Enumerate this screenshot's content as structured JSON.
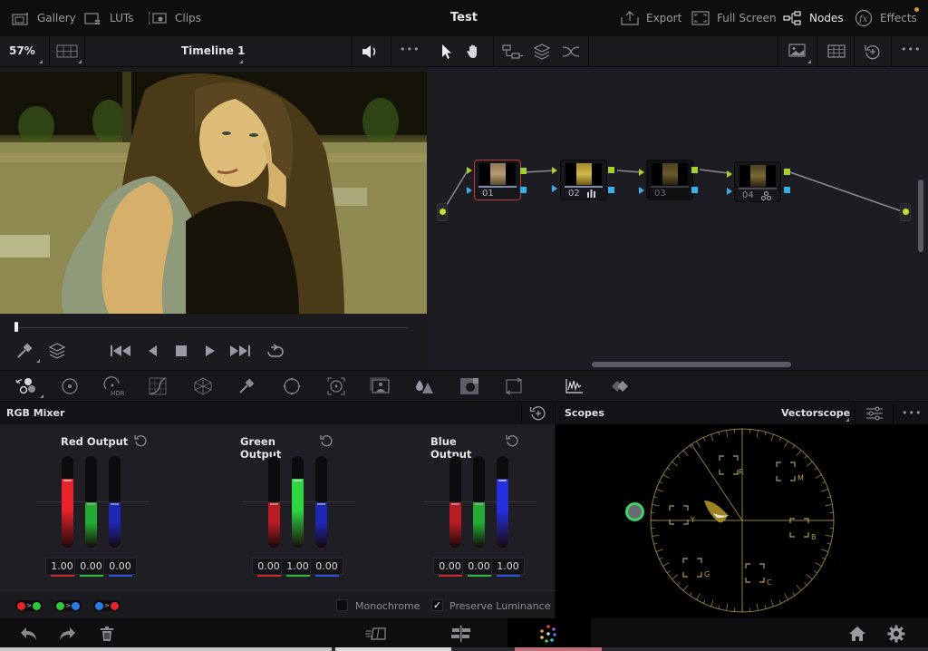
{
  "topbar": {
    "title": "Test",
    "left_items": [
      {
        "label": "Gallery",
        "icon": "gallery-icon"
      },
      {
        "label": "LUTs",
        "icon": "luts-icon"
      },
      {
        "label": "Clips",
        "icon": "clips-icon"
      }
    ],
    "right_items": [
      {
        "label": "Export",
        "icon": "export-icon"
      },
      {
        "label": "Full Screen",
        "icon": "fullscreen-icon"
      },
      {
        "label": "Nodes",
        "icon": "nodes-icon",
        "active": true
      },
      {
        "label": "Effects",
        "icon": "fx-icon"
      }
    ]
  },
  "viewer": {
    "zoom": "57%",
    "timeline": "Timeline 1",
    "more": "•••",
    "playhead_fraction": 0.0
  },
  "nodegraph": {
    "more": "•••",
    "nodes": [
      {
        "id": "01",
        "selected": true,
        "badge": ""
      },
      {
        "id": "02",
        "selected": false,
        "badge": "bars"
      },
      {
        "id": "03",
        "selected": false,
        "badge": ""
      },
      {
        "id": "04",
        "selected": false,
        "badge": "layer"
      }
    ]
  },
  "palette": {
    "tools": [
      "color-wheels",
      "primary-wheel",
      "hdr",
      "curves",
      "color-warper",
      "qualifier",
      "power-window",
      "tracker",
      "blur",
      "key",
      "sizing",
      "motion",
      "scopes",
      "stereo"
    ],
    "hdr_label": "HDR"
  },
  "rgb_mixer": {
    "title": "RGB Mixer",
    "groups": [
      {
        "label": "Red Output",
        "values": [
          "1.00",
          "0.00",
          "0.00"
        ],
        "levels": [
          1.0,
          0.0,
          0.0
        ]
      },
      {
        "label": "Green Output",
        "values": [
          "0.00",
          "1.00",
          "0.00"
        ],
        "levels": [
          0.0,
          1.0,
          0.0
        ]
      },
      {
        "label": "Blue Output",
        "values": [
          "0.00",
          "0.00",
          "1.00"
        ],
        "levels": [
          0.0,
          0.0,
          1.0
        ]
      }
    ],
    "monochrome_label": "Monochrome",
    "monochrome_checked": false,
    "preserve_label": "Preserve Luminance",
    "preserve_checked": true,
    "check_glyph": "✓"
  },
  "scopes": {
    "title": "Scopes",
    "mode": "Vectorscope",
    "more": "•••",
    "targets": [
      "R",
      "M",
      "B",
      "C",
      "G",
      "Y"
    ]
  },
  "colors": {
    "red": "#e8222a",
    "green": "#2ed840",
    "blue": "#2430e0",
    "accent_green": "#a8d02a",
    "accent_blue": "#3aaee8",
    "graticule": "#b49a50"
  }
}
